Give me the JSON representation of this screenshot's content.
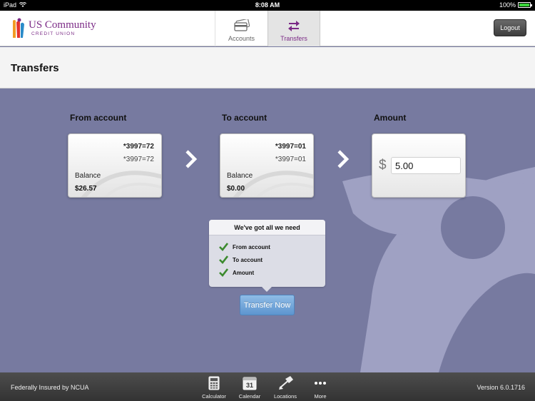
{
  "status_bar": {
    "device": "iPad",
    "time": "8:08 AM",
    "battery": "100%"
  },
  "header": {
    "logo": {
      "line1": "US Community",
      "line2": "CREDIT UNION"
    },
    "tabs": [
      {
        "label": "Accounts",
        "icon": "card-icon"
      },
      {
        "label": "Transfers",
        "icon": "transfer-arrows-icon"
      }
    ],
    "logout_label": "Logout"
  },
  "page": {
    "title": "Transfers"
  },
  "from_account": {
    "label": "From account",
    "account_primary": "*3997=72",
    "account_secondary": "*3997=72",
    "balance_label": "Balance",
    "balance_value": "$26.57"
  },
  "to_account": {
    "label": "To account",
    "account_primary": "*3997=01",
    "account_secondary": "*3997=01",
    "balance_label": "Balance",
    "balance_value": "$0.00"
  },
  "amount": {
    "label": "Amount",
    "currency": "$",
    "value": "5.00"
  },
  "checklist": {
    "title": "We've got all we need",
    "items": [
      "From account",
      "To account",
      "Amount"
    ]
  },
  "transfer_button": "Transfer Now",
  "bottom_bar": {
    "left_text": "Federally Insured by NCUA",
    "items": [
      {
        "label": "Calculator",
        "icon": "calculator-icon"
      },
      {
        "label": "Calendar",
        "icon": "calendar-icon",
        "icon_text": "31"
      },
      {
        "label": "Locations",
        "icon": "map-pin-icon"
      },
      {
        "label": "More",
        "icon": "more-dots-icon"
      }
    ],
    "version": "Version 6.0.1716"
  },
  "colors": {
    "brand": "#7b2a86",
    "background": "#777aa0",
    "button": "#6fa5d9",
    "check": "#3c8a2e"
  }
}
